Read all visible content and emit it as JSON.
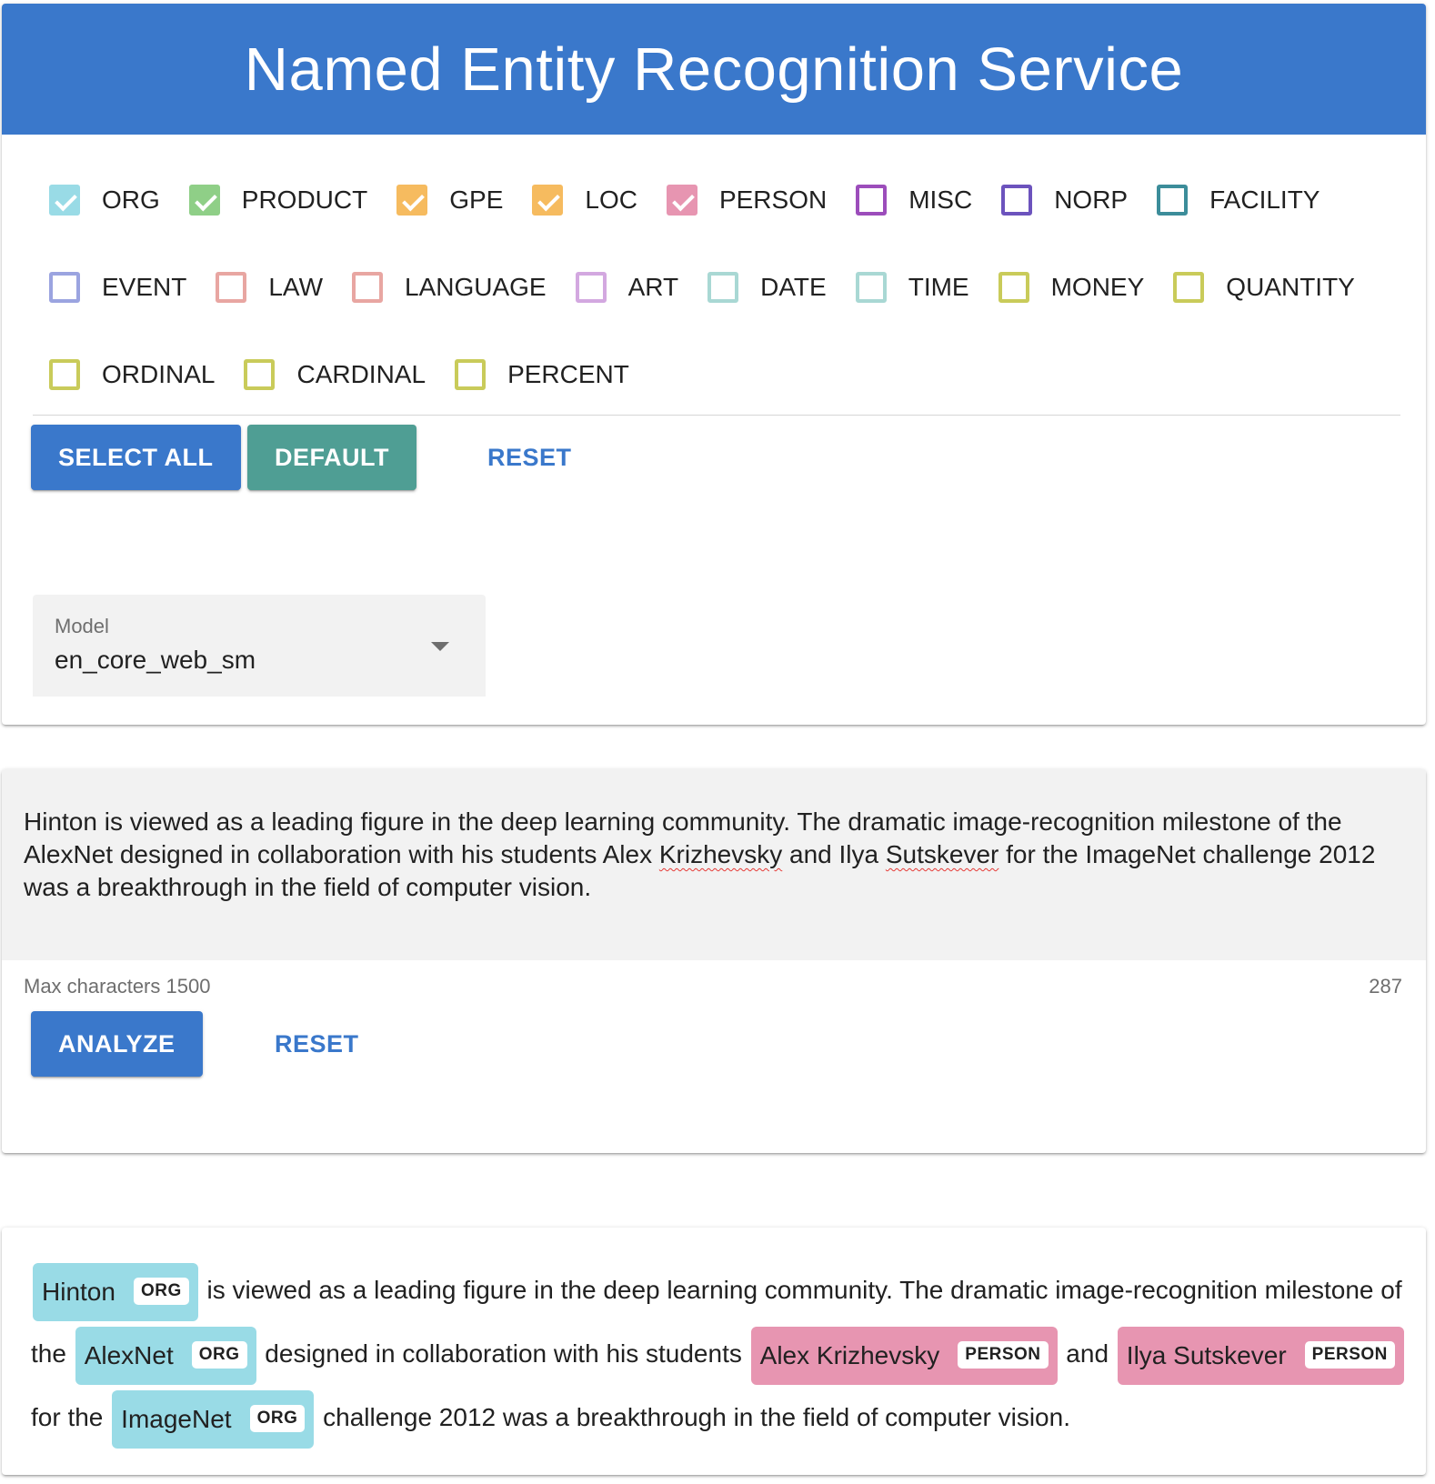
{
  "header": {
    "title": "Named Entity Recognition Service"
  },
  "entities": [
    {
      "label": "ORG",
      "checked": true,
      "color": "#99dbe6"
    },
    {
      "label": "PRODUCT",
      "checked": true,
      "color": "#8fcf87"
    },
    {
      "label": "GPE",
      "checked": true,
      "color": "#f6bb5f"
    },
    {
      "label": "LOC",
      "checked": true,
      "color": "#f6bb5f"
    },
    {
      "label": "PERSON",
      "checked": true,
      "color": "#e795b1"
    },
    {
      "label": "MISC",
      "checked": false,
      "color": "#9c4dbb"
    },
    {
      "label": "NORP",
      "checked": false,
      "color": "#6c53bd"
    },
    {
      "label": "FACILITY",
      "checked": false,
      "color": "#3c8d9a"
    },
    {
      "label": "EVENT",
      "checked": false,
      "color": "#9ba4e0"
    },
    {
      "label": "LAW",
      "checked": false,
      "color": "#e8a6a2"
    },
    {
      "label": "LANGUAGE",
      "checked": false,
      "color": "#e8a6a2"
    },
    {
      "label": "ART",
      "checked": false,
      "color": "#d3a8e0"
    },
    {
      "label": "DATE",
      "checked": false,
      "color": "#a9d8d4"
    },
    {
      "label": "TIME",
      "checked": false,
      "color": "#a9d8d4"
    },
    {
      "label": "MONEY",
      "checked": false,
      "color": "#c9cb5a"
    },
    {
      "label": "QUANTITY",
      "checked": false,
      "color": "#c9cb5a"
    },
    {
      "label": "ORDINAL",
      "checked": false,
      "color": "#c9cb5a"
    },
    {
      "label": "CARDINAL",
      "checked": false,
      "color": "#c9cb5a"
    },
    {
      "label": "PERCENT",
      "checked": false,
      "color": "#c9cb5a"
    }
  ],
  "config_buttons": {
    "select_all": "SELECT ALL",
    "default": "DEFAULT",
    "reset": "RESET"
  },
  "model_select": {
    "label": "Model",
    "value": "en_core_web_sm"
  },
  "input": {
    "text_parts": [
      {
        "text": "Hinton is viewed as a leading figure in the deep learning community. The dramatic image-recognition milestone of the AlexNet designed in collaboration with his students Alex ",
        "spell": false
      },
      {
        "text": "Krizhevsky",
        "spell": true
      },
      {
        "text": " and Ilya ",
        "spell": false
      },
      {
        "text": "Sutskever",
        "spell": true
      },
      {
        "text": " for the ImageNet challenge 2012 was a breakthrough in the field of computer vision.",
        "spell": false
      }
    ],
    "hint": "Max characters 1500",
    "counter": "287"
  },
  "input_buttons": {
    "analyze": "ANALYZE",
    "reset": "RESET"
  },
  "result": {
    "segments": [
      {
        "text": "Hinton",
        "entity": "ORG"
      },
      {
        "text": " is viewed as a leading figure in the deep learning community. The dramatic image-recognition milestone of the "
      },
      {
        "text": "AlexNet",
        "entity": "ORG"
      },
      {
        "text": " designed in collaboration with his students "
      },
      {
        "text": "Alex Krizhevsky",
        "entity": "PERSON"
      },
      {
        "text": " and "
      },
      {
        "text": "Ilya Sutskever",
        "entity": "PERSON"
      },
      {
        "text": " for the "
      },
      {
        "text": "ImageNet",
        "entity": "ORG"
      },
      {
        "text": " challenge 2012 was a breakthrough in the field of computer vision."
      }
    ]
  },
  "colors": {
    "primary": "#3a78cb",
    "teal": "#4f9e94",
    "org": "#99dbe6",
    "person": "#e795b1"
  }
}
